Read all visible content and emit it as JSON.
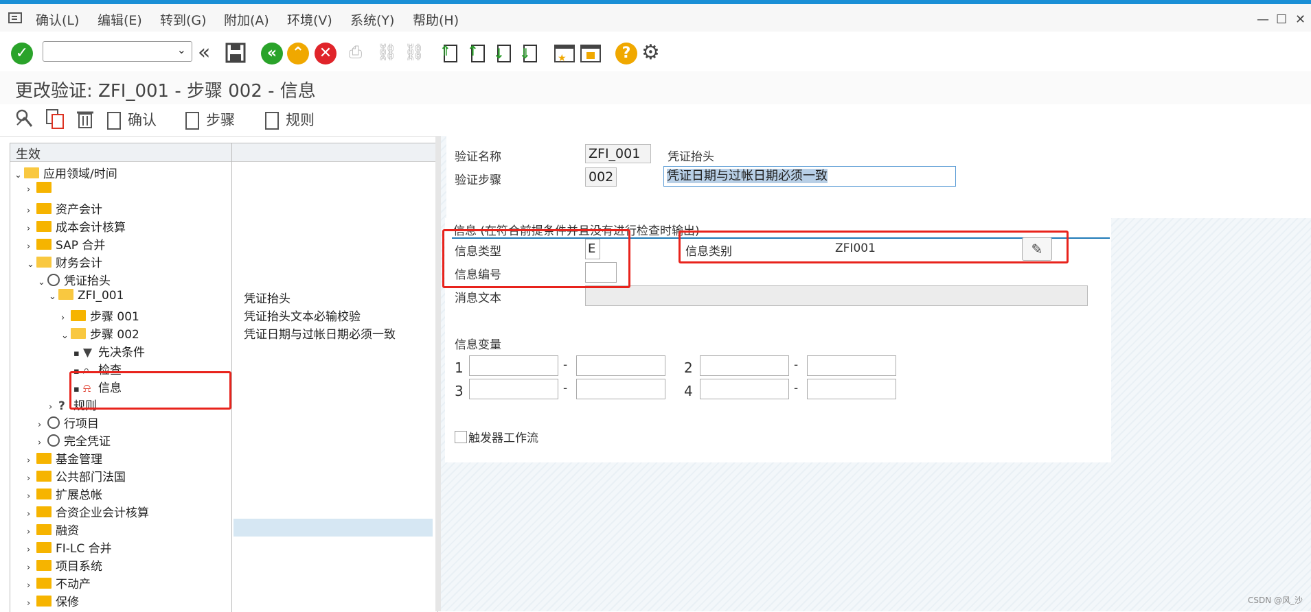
{
  "menubar": {
    "items": [
      "确认(L)",
      "编辑(E)",
      "转到(G)",
      "附加(A)",
      "环境(V)",
      "系统(Y)",
      "帮助(H)"
    ],
    "window_controls": [
      "—",
      "☐",
      "✕"
    ]
  },
  "toolbar": {
    "command_field_value": "",
    "icons": [
      "enter-icon",
      "back-double-icon",
      "save-icon",
      "back-icon",
      "exit-icon",
      "cancel-icon",
      "print-icon",
      "find-icon",
      "find-next-icon",
      "first-page-icon",
      "prev-page-icon",
      "next-page-icon",
      "last-page-icon",
      "create-session-icon",
      "shortcut-icon",
      "help-icon",
      "settings-icon"
    ]
  },
  "title": "更改验证: ZFI_001 - 步骤 002 - 信息",
  "app_toolbar": {
    "confirm_label": "确认",
    "step_label": "步骤",
    "rule_label": "规则"
  },
  "tree": {
    "header": "生效",
    "rows": [
      {
        "label": "应用领域/时间",
        "desc": ""
      },
      {
        "label": "",
        "desc": ""
      },
      {
        "label": "资产会计",
        "desc": ""
      },
      {
        "label": "成本会计核算",
        "desc": ""
      },
      {
        "label": "SAP 合并",
        "desc": ""
      },
      {
        "label": "财务会计",
        "desc": ""
      },
      {
        "label": "凭证抬头",
        "desc": ""
      },
      {
        "label": "ZFI_001",
        "desc": "凭证抬头"
      },
      {
        "label": "步骤 001",
        "desc": "凭证抬头文本必输校验"
      },
      {
        "label": "步骤 002",
        "desc": "凭证日期与过帐日期必须一致"
      },
      {
        "label": "先决条件",
        "desc": ""
      },
      {
        "label": "检查",
        "desc": ""
      },
      {
        "label": "信息",
        "desc": ""
      },
      {
        "label": "规则",
        "desc": ""
      },
      {
        "label": "行项目",
        "desc": ""
      },
      {
        "label": "完全凭证",
        "desc": ""
      },
      {
        "label": "基金管理",
        "desc": ""
      },
      {
        "label": "公共部门法国",
        "desc": ""
      },
      {
        "label": "扩展总帐",
        "desc": ""
      },
      {
        "label": "合资企业会计核算",
        "desc": ""
      },
      {
        "label": "融资",
        "desc": ""
      },
      {
        "label": "FI-LC 合并",
        "desc": ""
      },
      {
        "label": "项目系统",
        "desc": ""
      },
      {
        "label": "不动产",
        "desc": ""
      },
      {
        "label": "保修",
        "desc": ""
      }
    ]
  },
  "form": {
    "validation_name_label": "验证名称",
    "validation_name_value": "ZFI_001",
    "validation_name_desc": "凭证抬头",
    "validation_step_label": "验证步骤",
    "validation_step_value": "002",
    "validation_step_desc": "凭证日期与过帐日期必须一致"
  },
  "message_group": {
    "title": "信息 (在符合前提条件并且没有进行检查时输出)",
    "msg_type_label": "信息类型",
    "msg_type_value": "E",
    "msg_number_label": "信息编号",
    "msg_number_value": "",
    "msg_class_label": "信息类别",
    "msg_class_value": "ZFI001",
    "msg_text_label": "消息文本",
    "msg_text_value": "",
    "variables_label": "信息变量",
    "var_nums": [
      "1",
      "2",
      "3",
      "4"
    ],
    "dash": "-",
    "workflow_label": "触发器工作流"
  },
  "watermark": "CSDN @风_沙"
}
